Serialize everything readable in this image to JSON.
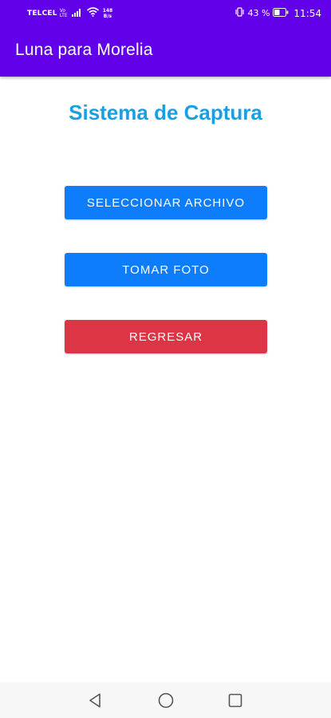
{
  "status_bar": {
    "carrier": "TELCEL",
    "volte_top": "Vo",
    "volte_bottom": "LTE",
    "speed_value": "148",
    "speed_unit": "B/s",
    "battery_percent": "43 %",
    "time": "11:54"
  },
  "app_bar": {
    "title": "Luna para Morelia",
    "color": "#6200ea"
  },
  "main": {
    "title": "Sistema de Captura",
    "title_color": "#1a9fe3",
    "buttons": {
      "select_file": "SELECCIONAR ARCHIVO",
      "take_photo": "TOMAR FOTO",
      "back": "REGRESAR"
    },
    "colors": {
      "primary_button": "#0d7dfb",
      "danger_button": "#dc3545"
    }
  },
  "nav_bar": {
    "icons": [
      "back-triangle-icon",
      "home-circle-icon",
      "recents-square-icon"
    ]
  }
}
